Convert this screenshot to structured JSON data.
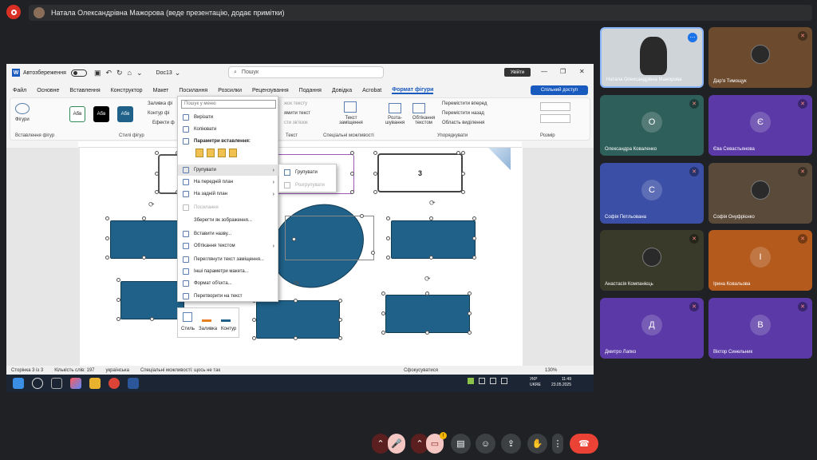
{
  "meeting": {
    "presenter_banner": "Натала Олександрівна Мажорова (веде презентацію, додає примітки)"
  },
  "word": {
    "autosave_label": "Автозбереження",
    "doc_name": "Doc13",
    "search_placeholder": "Пошук",
    "signin_label": "Увійти",
    "share_label": "Спільний доступ",
    "menu_tabs": [
      "Файл",
      "Основне",
      "Вставлення",
      "Конструктор",
      "Макет",
      "Посилання",
      "Розсилки",
      "Рецензування",
      "Подання",
      "Довідка",
      "Acrobat",
      "Формат фігури"
    ],
    "active_tab": "Формат фігури",
    "ribbon": {
      "insert_shapes_label": "Вставлення фігур",
      "shapes_btn": "Фігури",
      "styles_label": "Стилі фігур",
      "style_abv": "Абв",
      "fill_label": "Заливка фі",
      "outline_label": "Контур фі",
      "effects_label": "Ефекти ф",
      "wordart_text": "жок тексту",
      "text_dir": "ямити текст",
      "align_text": "сти зв'язок",
      "text_group_label": "Текст",
      "alt_text_btn": "Текст заміщення",
      "access_label": "Спеціальні можливості",
      "position_btn": "Розта-шування",
      "wrap_btn": "Обтікання текстом",
      "bring_forward": "Перемістити вперед",
      "send_backward": "Перемістити назад",
      "selection_pane": "Область виділення",
      "arrange_label": "Упорядкувати",
      "size_label": "Розмір"
    },
    "shape_label_3": "3",
    "status": {
      "page": "Сторінка 3 із 3",
      "words": "Кількість слів: 197",
      "lang": "українська",
      "accessibility": "Спеціальні можливості: щось не так",
      "focus": "Сфокусуватися",
      "zoom": "130%"
    },
    "context_menu": {
      "search_placeholder": "Пошук у меню",
      "cut": "Вирізати",
      "copy": "Копіювати",
      "paste_options": "Параметри вставлення:",
      "group": "Групувати",
      "bring_front": "На передній план",
      "send_back": "На задній план",
      "link": "Посилання",
      "save_as_picture": "Зберегти як зображення...",
      "insert_caption": "Вставити назву...",
      "wrap_text": "Обтікання текстом",
      "view_alt_text": "Переглянути текст заміщення...",
      "more_layout": "Інші параметри макета...",
      "format_object": "Формат об'єкта...",
      "convert_to_text": "Перетворити на текст"
    },
    "submenu": {
      "group": "Групувати",
      "ungroup": "Розгрупувати"
    },
    "mini_toolbar": {
      "style": "Стиль",
      "fill": "Заливка",
      "outline": "Контур"
    }
  },
  "taskbar": {
    "lang": "УКР",
    "lang2": "UKRE",
    "time": "11:49",
    "date": "23.05.2025"
  },
  "participants": [
    {
      "name": "Натала Олександрівна Мажорова",
      "initial": "",
      "color": "#3a3a3a",
      "kind": "video"
    },
    {
      "name": "Дар'я Тимощук",
      "initial": "",
      "color": "#6b4a2e",
      "kind": "photo"
    },
    {
      "name": "Олександра Коваленко",
      "initial": "О",
      "color": "#2f5f5a",
      "kind": "letter"
    },
    {
      "name": "Єва Севастьянова",
      "initial": "Є",
      "color": "#5b3aa8",
      "kind": "letter"
    },
    {
      "name": "Софія Петльована",
      "initial": "С",
      "color": "#3b4fa6",
      "kind": "letter"
    },
    {
      "name": "Софія Онуфрієнко",
      "initial": "",
      "color": "#5a4a3a",
      "kind": "photo"
    },
    {
      "name": "Анастасія Компанієць",
      "initial": "",
      "color": "#3a3a2a",
      "kind": "photo"
    },
    {
      "name": "Ірина Ковальова",
      "initial": "І",
      "color": "#b45a1c",
      "kind": "letter"
    },
    {
      "name": "Дмитро Лапко",
      "initial": "Д",
      "color": "#5b3aa8",
      "kind": "letter"
    },
    {
      "name": "Віктор Синельник",
      "initial": "В",
      "color": "#5b3aa8",
      "kind": "letter"
    }
  ],
  "controls": {
    "badge": "!"
  }
}
